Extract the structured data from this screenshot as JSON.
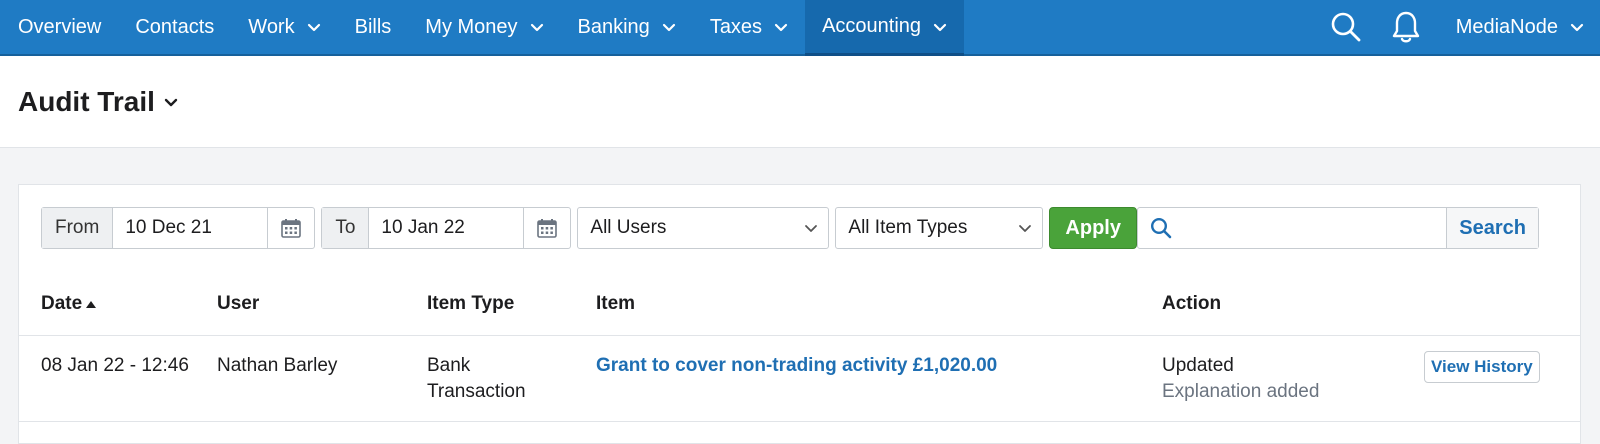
{
  "nav": {
    "items": [
      {
        "label": "Overview",
        "dropdown": false
      },
      {
        "label": "Contacts",
        "dropdown": false
      },
      {
        "label": "Work",
        "dropdown": true
      },
      {
        "label": "Bills",
        "dropdown": false
      },
      {
        "label": "My Money",
        "dropdown": true
      },
      {
        "label": "Banking",
        "dropdown": true
      },
      {
        "label": "Taxes",
        "dropdown": true
      },
      {
        "label": "Accounting",
        "dropdown": true,
        "active": true
      }
    ],
    "user": "MediaNode",
    "icons": [
      "search-icon",
      "bell-icon"
    ]
  },
  "page": {
    "title": "Audit Trail"
  },
  "filters": {
    "from_label": "From",
    "from_value": "10 Dec 21",
    "to_label": "To",
    "to_value": "10 Jan 22",
    "users_select": "All Users",
    "types_select": "All Item Types",
    "apply_label": "Apply",
    "search_value": "",
    "search_label": "Search"
  },
  "table": {
    "headers": {
      "date": "Date",
      "user": "User",
      "item_type": "Item Type",
      "item": "Item",
      "action": "Action"
    },
    "sort": {
      "column": "date",
      "direction": "asc"
    },
    "rows": [
      {
        "date": "08 Jan 22 - 12:46",
        "user": "Nathan Barley",
        "item_type_line1": "Bank",
        "item_type_line2": "Transaction",
        "item": "Grant to cover non-trading activity £1,020.00",
        "action": "Updated",
        "action_detail": "Explanation added",
        "history_label": "View History"
      }
    ]
  },
  "colors": {
    "nav_bg": "#1f7bc4",
    "nav_active": "#1669ad",
    "apply_green": "#4aa33a",
    "link_blue": "#1f6fb3"
  }
}
